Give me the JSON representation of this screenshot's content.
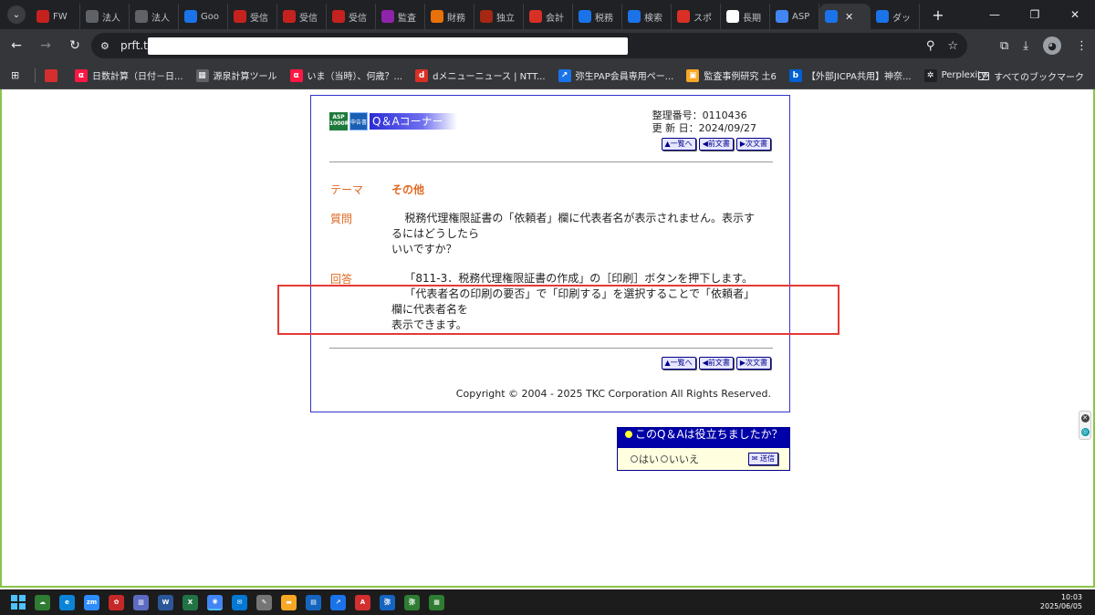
{
  "browser": {
    "tabs": [
      {
        "label": "FW",
        "favicon": "gmail-icon",
        "color": "#c5221f"
      },
      {
        "label": "法人",
        "favicon": "globe-icon",
        "color": "#5f6368"
      },
      {
        "label": "法人",
        "favicon": "globe-icon",
        "color": "#5f6368"
      },
      {
        "label": "Goo",
        "favicon": "docs-icon",
        "color": "#1a73e8"
      },
      {
        "label": "受信",
        "favicon": "gmail-icon",
        "color": "#c5221f"
      },
      {
        "label": "受信",
        "favicon": "gmail-icon",
        "color": "#c5221f"
      },
      {
        "label": "受信",
        "favicon": "gmail-icon",
        "color": "#c5221f"
      },
      {
        "label": "監査",
        "favicon": "contacts-icon",
        "color": "#8e24aa"
      },
      {
        "label": "財務",
        "favicon": "contacts-icon",
        "color": "#e8710a"
      },
      {
        "label": "独立",
        "favicon": "book-icon",
        "color": "#a52714"
      },
      {
        "label": "会計",
        "favicon": "g-icon",
        "color": "#d93025"
      },
      {
        "label": "税務",
        "favicon": "shield-icon",
        "color": "#1a73e8"
      },
      {
        "label": "検索",
        "favicon": "shield-icon",
        "color": "#1a73e8"
      },
      {
        "label": "スポ",
        "favicon": "d-icon",
        "color": "#d93025"
      },
      {
        "label": "長期",
        "favicon": "wikipedia-icon",
        "color": "#ffffff"
      },
      {
        "label": "ASP",
        "favicon": "google-icon",
        "color": "#4285f4"
      },
      {
        "label": "",
        "favicon": "tkc-icon",
        "color": "#1a73e8",
        "active": true
      },
      {
        "label": "ダッ",
        "favicon": "shield-icon",
        "color": "#1a73e8"
      }
    ],
    "tab_search_glyph": "⌄",
    "new_tab_glyph": "+",
    "window_controls": {
      "minimize": "—",
      "restore": "❐",
      "close": "✕"
    },
    "url": "prft.tk",
    "nav": {
      "back": "←",
      "forward": "→",
      "reload": "↻"
    },
    "omnibox_icons": {
      "zoom": "⚲",
      "bookmark_star": "☆"
    },
    "toolbar_icons": {
      "extensions": "⧉",
      "download": "⤓",
      "profile": "◕",
      "menu": "⋮"
    },
    "apps_glyph": "⊞",
    "bookmarks": [
      {
        "label": "",
        "favicon": "tkc-red-icon",
        "color": "#d32f2f"
      },
      {
        "label": "日数計算（日付－日...",
        "favicon": "alpha-icon",
        "color": "#ff1744",
        "glyph": "α"
      },
      {
        "label": "源泉計算ツール",
        "favicon": "calculator-icon",
        "color": "#5f6368",
        "glyph": "▦"
      },
      {
        "label": "いま（当時）、何歳？...",
        "favicon": "alpha-icon",
        "color": "#ff1744",
        "glyph": "α"
      },
      {
        "label": "dメニューニュース | NTT...",
        "favicon": "d-icon",
        "color": "#d93025",
        "glyph": "d"
      },
      {
        "label": "弥生PAP会員専用ペー...",
        "favicon": "arrow-icon",
        "color": "#1a73e8",
        "glyph": "↗"
      },
      {
        "label": "監査事例研究 土6",
        "favicon": "contacts-icon",
        "color": "#f9a825",
        "glyph": "▣"
      },
      {
        "label": "【外部JICPA共用】神奈...",
        "favicon": "box-icon",
        "color": "#0061d5",
        "glyph": "b"
      },
      {
        "label": "Perplexity",
        "favicon": "perplexity-icon",
        "color": "#202124",
        "glyph": "✲"
      }
    ],
    "bookmarks_more": "»",
    "all_bookmarks": "すべてのブックマーク"
  },
  "qa": {
    "asp_badge": "ASP 1000R",
    "shinkoku_badge": "申告書",
    "corner_title": "Q＆Aコーナー",
    "meta": {
      "number_label": "整理番号：",
      "number": "0110436",
      "updated_label": "更 新 日：",
      "updated": "2024/09/27"
    },
    "nav_buttons": {
      "index": "▲一覧へ",
      "prev": "◀前文書",
      "next": "▶次文書"
    },
    "theme_label": "テーマ",
    "theme_value": "その他",
    "question_label": "質問",
    "question_line1": "税務代理権限証書の「依頼者」欄に代表者名が表示されません。表示す",
    "question_line2": "るにはどうしたら",
    "question_line3": "いいですか？",
    "answer_label": "回答",
    "answer_line1": "「811-3．税務代理権限証書の作成」の［印刷］ボタンを押下します。",
    "answer_line2": "「代表者名の印刷の要否」で「印刷する」を選択することで「依頼者」",
    "answer_line3": "欄に代表者名を",
    "answer_line4": "表示できます。",
    "copyright": "Copyright © 2004 - 2025 TKC Corporation All Rights Reserved."
  },
  "feedback": {
    "question": "このQ＆Aは役立ちましたか？",
    "yes": "はい",
    "no": "いいえ",
    "send": "送信"
  },
  "colors": {
    "accent_orange": "#e06820",
    "frame_blue": "#3333cc",
    "highlight_red": "#e53935",
    "viewport_green": "#8bc34a"
  },
  "taskbar": {
    "apps": [
      {
        "name": "weather-icon",
        "color": "#2e7d32",
        "glyph": "☁"
      },
      {
        "name": "edge-icon",
        "color": "#0a84d6",
        "glyph": "e"
      },
      {
        "name": "zoom-icon",
        "color": "#2d8cff",
        "glyph": "zm"
      },
      {
        "name": "app-icon",
        "color": "#c62828",
        "glyph": "✿"
      },
      {
        "name": "app-icon",
        "color": "#5c6bc0",
        "glyph": "▥"
      },
      {
        "name": "word-icon",
        "color": "#2b579a",
        "glyph": "W"
      },
      {
        "name": "excel-icon",
        "color": "#217346",
        "glyph": "X"
      },
      {
        "name": "chrome-icon",
        "color": "#4285f4",
        "glyph": "◉",
        "active": true
      },
      {
        "name": "mail-icon",
        "color": "#0078d4",
        "glyph": "✉"
      },
      {
        "name": "pen-icon",
        "color": "#757575",
        "glyph": "✎"
      },
      {
        "name": "folder-icon",
        "color": "#f9a825",
        "glyph": "▬"
      },
      {
        "name": "app-icon",
        "color": "#1565c0",
        "glyph": "▤"
      },
      {
        "name": "arrow-icon",
        "color": "#1a73e8",
        "glyph": "↗"
      },
      {
        "name": "acrobat-icon",
        "color": "#d32f2f",
        "glyph": "A"
      },
      {
        "name": "app-icon",
        "color": "#1565c0",
        "glyph": "弥"
      },
      {
        "name": "app-icon",
        "color": "#2e7d32",
        "glyph": "弥"
      },
      {
        "name": "app-icon",
        "color": "#2e7d32",
        "glyph": "▦"
      }
    ],
    "time": "10:03",
    "date": "2025/06/05"
  }
}
